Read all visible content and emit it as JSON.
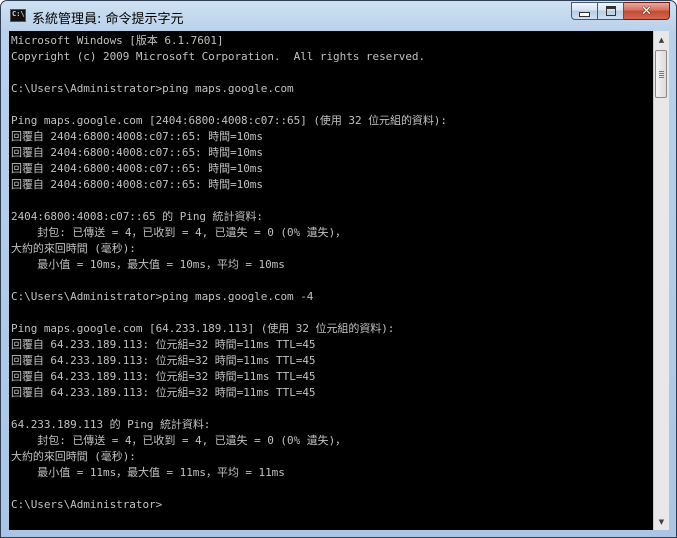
{
  "window": {
    "title": "系統管理員: 命令提示字元",
    "icon": "cmd-icon",
    "buttons": {
      "minimize": "minimize-icon",
      "maximize": "maximize-icon",
      "close": "✕"
    }
  },
  "console": {
    "lines": [
      "Microsoft Windows [版本 6.1.7601]",
      "Copyright (c) 2009 Microsoft Corporation.  All rights reserved.",
      "",
      "C:\\Users\\Administrator>ping maps.google.com",
      "",
      "Ping maps.google.com [2404:6800:4008:c07::65] (使用 32 位元組的資料):",
      "回覆自 2404:6800:4008:c07::65: 時間=10ms",
      "回覆自 2404:6800:4008:c07::65: 時間=10ms",
      "回覆自 2404:6800:4008:c07::65: 時間=10ms",
      "回覆自 2404:6800:4008:c07::65: 時間=10ms",
      "",
      "2404:6800:4008:c07::65 的 Ping 統計資料:",
      "    封包: 已傳送 = 4，已收到 = 4, 已遺失 = 0 (0% 遺失)，",
      "大約的來回時間 (毫秒):",
      "    最小值 = 10ms，最大值 = 10ms，平均 = 10ms",
      "",
      "C:\\Users\\Administrator>ping maps.google.com -4",
      "",
      "Ping maps.google.com [64.233.189.113] (使用 32 位元組的資料):",
      "回覆自 64.233.189.113: 位元組=32 時間=11ms TTL=45",
      "回覆自 64.233.189.113: 位元組=32 時間=11ms TTL=45",
      "回覆自 64.233.189.113: 位元組=32 時間=11ms TTL=45",
      "回覆自 64.233.189.113: 位元組=32 時間=11ms TTL=45",
      "",
      "64.233.189.113 的 Ping 統計資料:",
      "    封包: 已傳送 = 4，已收到 = 4, 已遺失 = 0 (0% 遺失)，",
      "大約的來回時間 (毫秒):",
      "    最小值 = 11ms，最大值 = 11ms，平均 = 11ms",
      "",
      "C:\\Users\\Administrator>"
    ]
  },
  "scrollbar": {
    "up_icon": "scroll-up-arrow-icon",
    "down_icon": "scroll-down-arrow-icon"
  },
  "colors": {
    "console_bg": "#000000",
    "console_text": "#c0c0c0",
    "close_button": "#c24a35"
  }
}
